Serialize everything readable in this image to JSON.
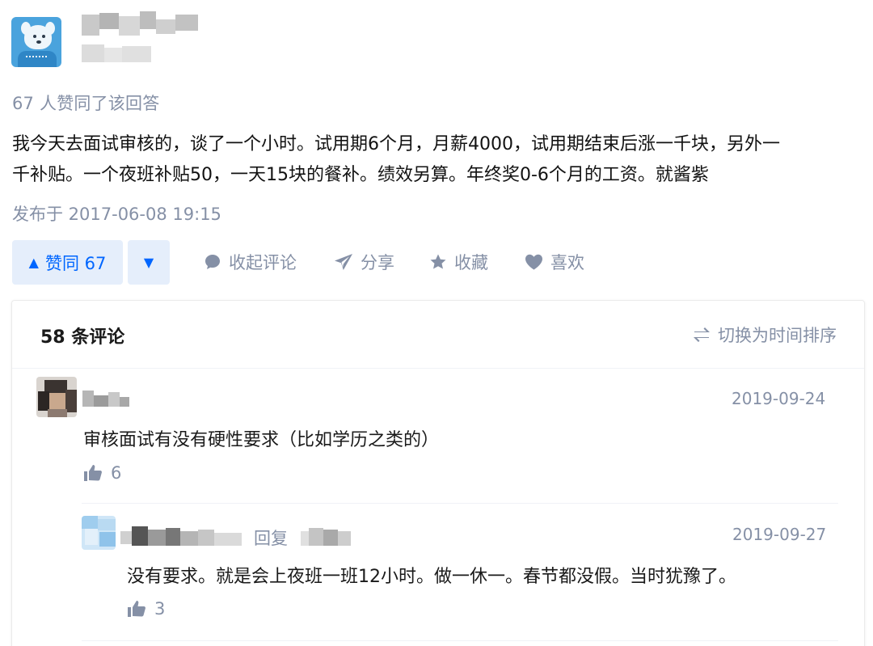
{
  "answer": {
    "author": {
      "name": "",
      "headline": "",
      "avatar_icon": "dog-avatar-icon"
    },
    "vote_count_line": "67 人赞同了该回答",
    "content_lines": [
      "我今天去面试审核的，谈了一个小时。试用期6个月，月薪4000，试用期结束后涨一千块，另外一",
      "千补贴。一个夜班补贴50，一天15块的餐补。绩效另算。年终奖0-6个月的工资。就酱紫"
    ],
    "publish_time": "发布于 2017-06-08 19:15"
  },
  "actions": {
    "upvote_icon": "▲",
    "upvote_label": "赞同 67",
    "downvote_icon": "▼",
    "collapse_comments_label": "收起评论",
    "share_label": "分享",
    "favorite_label": "收藏",
    "like_label": "喜欢"
  },
  "comments": {
    "title": "58 条评论",
    "sort_toggle_label": "切换为时间排序",
    "items": [
      {
        "author": "",
        "date": "2019-09-24",
        "text": "审核面试有没有硬性要求（比如学历之类的）",
        "likes": "6"
      },
      {
        "author": "",
        "reply_word": "回复",
        "reply_to": "",
        "date": "2019-09-27",
        "text": "没有要求。就是会上夜班一班12小时。做一休一。春节都没假。当时犹豫了。",
        "likes": "3"
      }
    ]
  },
  "colors": {
    "accent_blue": "#0066ff",
    "upvote_bg": "#e5eefb",
    "meta_gray": "#8590a6",
    "text_primary": "#121212"
  }
}
